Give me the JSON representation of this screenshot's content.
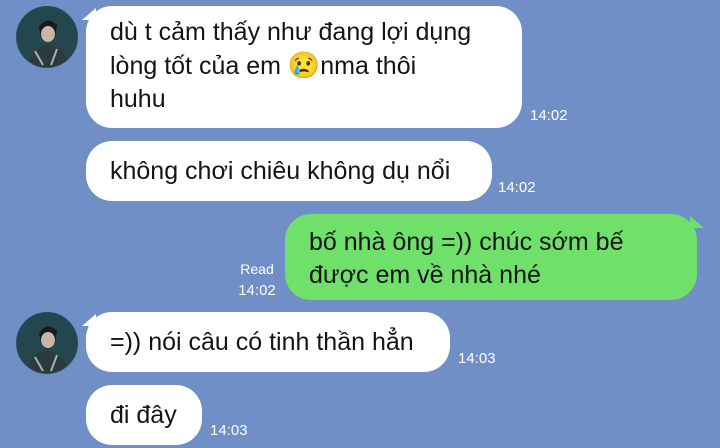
{
  "messages": [
    {
      "sender": "contact",
      "lines": [
        "dù t cảm thấy như đang lợi dụng",
        "lòng tốt của em ",
        "nma thôi",
        "huhu"
      ],
      "emoji": "😢",
      "time": "14:02"
    },
    {
      "sender": "contact",
      "text": "không chơi chiêu không dụ nổi",
      "time": "14:02"
    },
    {
      "sender": "me",
      "lines": [
        "bố nhà ông =)) chúc sớm bế",
        "được em về nhà nhé"
      ],
      "read": "Read",
      "time": "14:02"
    },
    {
      "sender": "contact",
      "text": "=)) nói câu có tinh thần hẳn",
      "time": "14:03"
    },
    {
      "sender": "contact",
      "text": "đi đây",
      "time": "14:03"
    }
  ],
  "colors": {
    "background": "#6f8fc6",
    "incoming_bubble": "#ffffff",
    "outgoing_bubble": "#6fe069"
  },
  "icons": [
    "contact-avatar",
    "crying-face-emoji"
  ]
}
